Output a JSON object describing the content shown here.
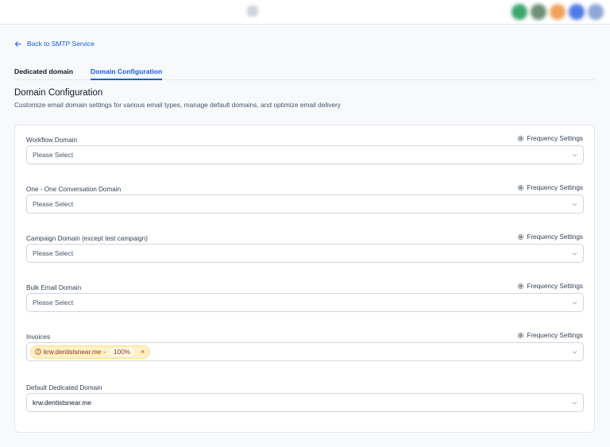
{
  "header": {
    "avatars": [
      "#3aa76d",
      "#6f8f7a",
      "#f4a25b",
      "#4f7be8",
      "#8ea6d8"
    ]
  },
  "nav": {
    "back_label": "Back to SMTP Service"
  },
  "tabs": [
    {
      "label": "Dedicated domain",
      "active": false
    },
    {
      "label": "Domain Configuration",
      "active": true
    }
  ],
  "page": {
    "title": "Domain Configuration",
    "subtitle": "Customize email domain settings for various email types, manage default domains, and optimize email delivery"
  },
  "fields": [
    {
      "label": "Workflow Domain",
      "freq_label": "Frequency Settings",
      "placeholder": "Please Select"
    },
    {
      "label": "One - One Conversation Domain",
      "freq_label": "Frequency Settings",
      "placeholder": "Please Select"
    },
    {
      "label": "Campaign Domain (except test campaign)",
      "freq_label": "Frequency Settings",
      "placeholder": "Please Select"
    },
    {
      "label": "Bulk Email Domain",
      "freq_label": "Frequency Settings",
      "placeholder": "Please Select"
    },
    {
      "label": "Invoices",
      "freq_label": "Frequency Settings",
      "chip": {
        "domain": "krw.dentistsnear.me",
        "separator": "-",
        "percent": "100%",
        "remove": "×"
      }
    },
    {
      "label": "Default Dedicated Domain",
      "value": "krw.dentistsnear.me"
    }
  ],
  "colors": {
    "accent": "#155eef",
    "warning_bg": "#fef0c7",
    "warning_text": "#93370d"
  }
}
